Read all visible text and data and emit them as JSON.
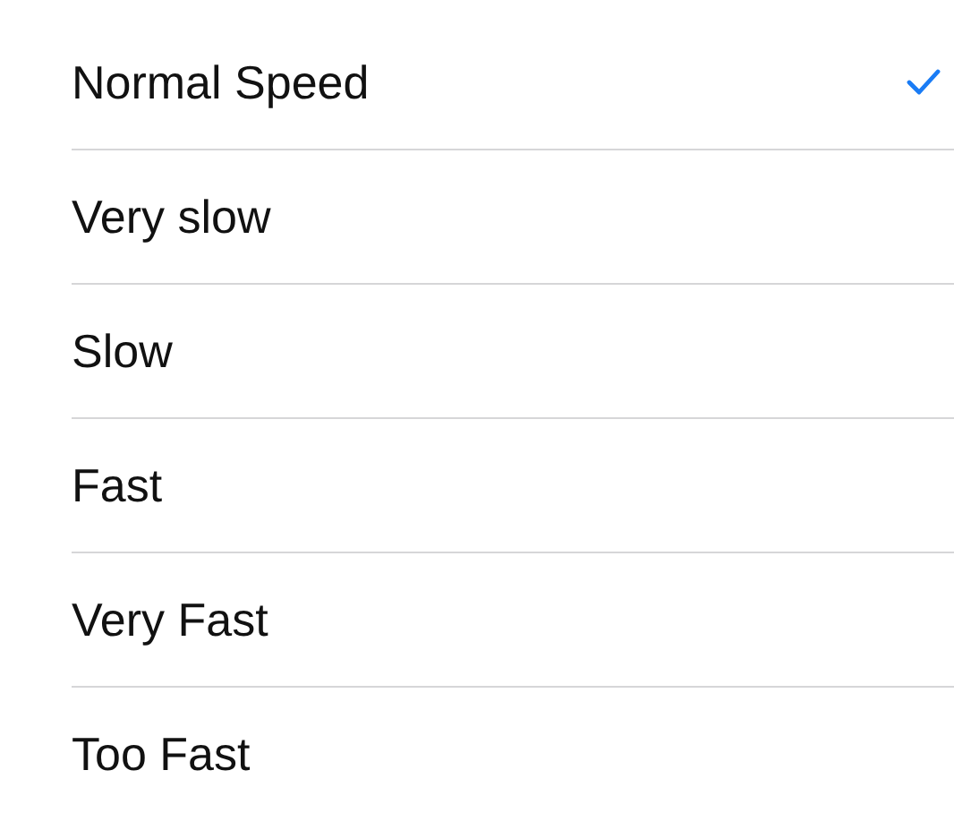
{
  "options": [
    {
      "label": "Normal Speed",
      "selected": true
    },
    {
      "label": "Very slow",
      "selected": false
    },
    {
      "label": "Slow",
      "selected": false
    },
    {
      "label": "Fast",
      "selected": false
    },
    {
      "label": "Very Fast",
      "selected": false
    },
    {
      "label": "Too Fast",
      "selected": false
    }
  ]
}
